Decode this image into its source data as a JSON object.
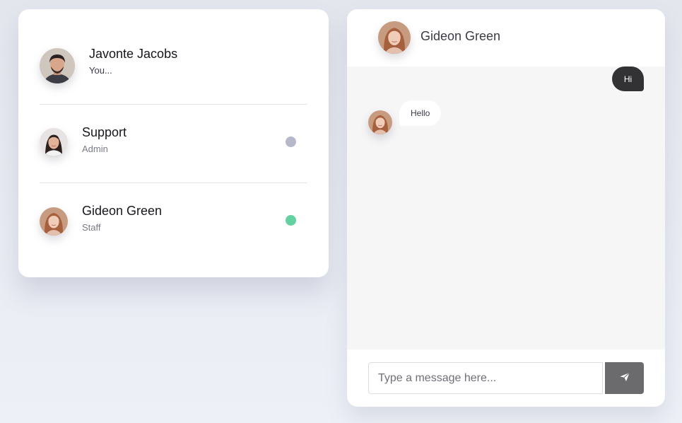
{
  "current_user": {
    "name": "Javonte Jacobs",
    "subtitle": "You..."
  },
  "contacts": [
    {
      "name": "Support",
      "role": "Admin",
      "status": "offline",
      "status_color": "#b6b7c8"
    },
    {
      "name": "Gideon Green",
      "role": "Staff",
      "status": "online",
      "status_color": "#64d1a1"
    }
  ],
  "chat": {
    "header_name": "Gideon Green",
    "messages": [
      {
        "direction": "outgoing",
        "text": "Hi"
      },
      {
        "direction": "incoming",
        "text": "Hello"
      }
    ],
    "input_placeholder": "Type a message here...",
    "send_icon": "paper-plane-icon"
  },
  "colors": {
    "outgoing_bubble": "#323234",
    "send_button": "#6b6b6e",
    "online": "#64d1a1",
    "offline": "#b6b7c8"
  }
}
